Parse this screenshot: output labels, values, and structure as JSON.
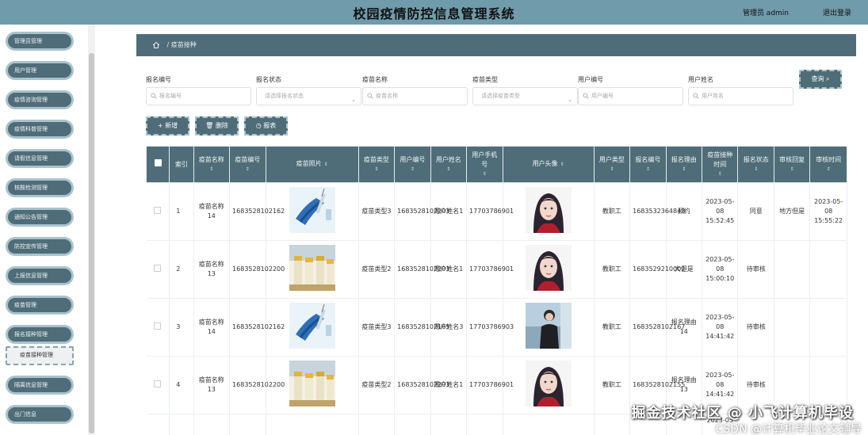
{
  "header": {
    "title": "校园疫情防控信息管理系统",
    "admin": "管理员 admin",
    "logout": "退出登录"
  },
  "sidebar": {
    "items": [
      {
        "label": "管理员管理"
      },
      {
        "label": "用户管理"
      },
      {
        "label": "疫情咨询管理"
      },
      {
        "label": "疫情科普管理"
      },
      {
        "label": "请假信息管理"
      },
      {
        "label": "核酸检测管理"
      },
      {
        "label": "通知公告管理"
      },
      {
        "label": "防控宣传管理"
      },
      {
        "label": "上报信息管理"
      },
      {
        "label": "疫苗管理"
      },
      {
        "label": "报名接种管理"
      },
      {
        "label": "疫苗接种管理"
      },
      {
        "label": "隔离信息管理"
      },
      {
        "label": "出门信息"
      }
    ],
    "active_index": 11
  },
  "breadcrumb": {
    "current": "疫苗接种"
  },
  "search": {
    "fields": [
      {
        "label": "报名编号",
        "placeholder": "报名编号",
        "type": "input"
      },
      {
        "label": "报名状态",
        "placeholder": "请选择报名状态",
        "type": "select"
      },
      {
        "label": "疫苗名称",
        "placeholder": "疫苗名称",
        "type": "input"
      },
      {
        "label": "疫苗类型",
        "placeholder": "请选择疫苗类型",
        "type": "select"
      },
      {
        "label": "用户编号",
        "placeholder": "用户编号",
        "type": "input"
      },
      {
        "label": "用户姓名",
        "placeholder": "用户姓名",
        "type": "input"
      }
    ],
    "query_label": "查询 ⌕"
  },
  "actions": {
    "add": "+ 新增",
    "delete": "🗑 删除",
    "report": "◷ 报表"
  },
  "table": {
    "headers": [
      "索引",
      "疫苗名称",
      "疫苗编号",
      "疫苗照片",
      "疫苗类型",
      "用户编号",
      "用户姓名",
      "用户手机号",
      "用户头像",
      "用户类型",
      "报名编号",
      "报名理由",
      "疫苗接种时间",
      "报名状态",
      "审核回复",
      "审核时间"
    ],
    "rows": [
      {
        "index": "1",
        "vaccine_name": "疫苗名称14",
        "vaccine_no": "1683528102162",
        "photo": "syringe",
        "vaccine_type": "疫苗类型3",
        "user_no": "1683528102203",
        "user_name": "用户姓名1",
        "phone": "17703786901",
        "avatar": "girl",
        "user_type": "教职工",
        "signup_no": "1683532364843",
        "reason": "预约",
        "time": "2023-05-08 15:52:45",
        "status": "同意",
        "reply": "地方但是",
        "audit_time": "2023-05-08 15:55:22"
      },
      {
        "index": "2",
        "vaccine_name": "疫苗名称13",
        "vaccine_no": "1683528102200",
        "photo": "vials",
        "vaccine_type": "疫苗类型2",
        "user_no": "1683528102203",
        "user_name": "用户姓名1",
        "phone": "17703786901",
        "avatar": "girl",
        "user_type": "教职工",
        "signup_no": "1683529210002",
        "reason": "大但是",
        "time": "2023-05-08 15:00:10",
        "status": "待审核",
        "reply": "",
        "audit_time": ""
      },
      {
        "index": "3",
        "vaccine_name": "疫苗名称14",
        "vaccine_no": "1683528102162",
        "photo": "syringe",
        "vaccine_type": "疫苗类型3",
        "user_no": "1683528102165",
        "user_name": "用户姓名3",
        "phone": "17703786903",
        "avatar": "outdoor",
        "user_type": "教职工",
        "signup_no": "1683528102167",
        "reason": "报名理由14",
        "time": "2023-05-08 14:41:42",
        "status": "待审核",
        "reply": "",
        "audit_time": ""
      },
      {
        "index": "4",
        "vaccine_name": "疫苗名称13",
        "vaccine_no": "1683528102200",
        "photo": "vials",
        "vaccine_type": "疫苗类型2",
        "user_no": "1683528102203",
        "user_name": "用户姓名1",
        "phone": "17703786901",
        "avatar": "girl",
        "user_type": "教职工",
        "signup_no": "1683528102155",
        "reason": "报名理由13",
        "time": "2023-05-08 14:41:42",
        "status": "待审核",
        "reply": "",
        "audit_time": ""
      }
    ],
    "partial_time": "2023-05"
  },
  "watermark": {
    "line1": "掘金技术社区 @ 小飞计算机毕设",
    "line2": "CSDN @计算机毕业论文辅导"
  }
}
